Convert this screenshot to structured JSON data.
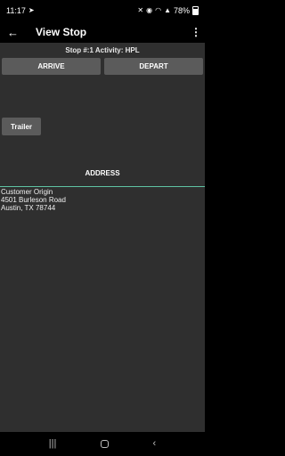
{
  "status_bar": {
    "time": "11:17",
    "battery": "78%",
    "icons": [
      "send-icon",
      "mute-icon",
      "location-icon",
      "wifi-icon",
      "signal-icon",
      "battery-icon"
    ]
  },
  "app_bar": {
    "title": "View Stop",
    "back_icon": "arrow-left-icon",
    "menu_icon": "more-vert-icon"
  },
  "stop": {
    "info": "Stop #:1 Activity: HPL"
  },
  "buttons": {
    "arrive": "ARRIVE",
    "depart": "DEPART",
    "trailer": "Trailer"
  },
  "address": {
    "heading": "ADDRESS",
    "lines": [
      "Customer Origin",
      "4501 Burleson Road",
      "Austin, TX 78744"
    ]
  },
  "colors": {
    "accent_divider": "#5fc3a3",
    "button_bg": "#5b5b5b",
    "content_bg": "#2f2f2f"
  },
  "nav_bar": {
    "icons": [
      "recents-icon",
      "home-icon",
      "back-nav-icon"
    ]
  }
}
